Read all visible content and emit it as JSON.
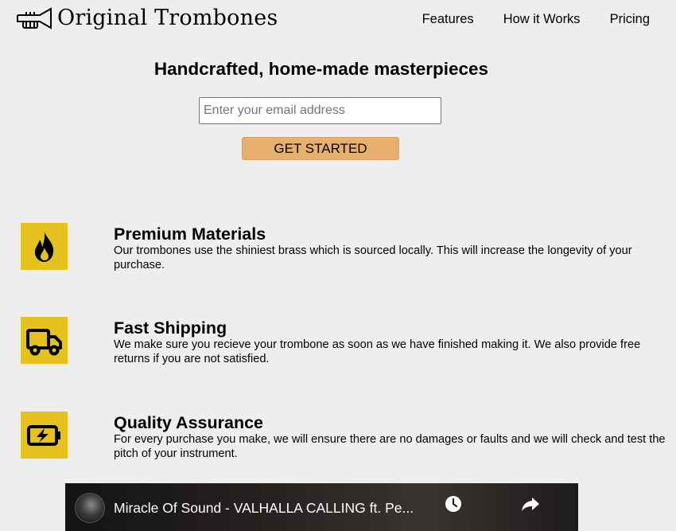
{
  "header": {
    "brand": "Original Trombones",
    "nav": [
      {
        "label": "Features"
      },
      {
        "label": "How it Works"
      },
      {
        "label": "Pricing"
      }
    ]
  },
  "hero": {
    "title": "Handcrafted, home-made masterpieces",
    "email_placeholder": "Enter your email address",
    "email_value": "",
    "cta_label": "GET STARTED"
  },
  "features": [
    {
      "icon": "fire-icon",
      "title": "Premium Materials",
      "description": "Our trombones use the shiniest brass which is sourced locally. This will increase the longevity of your purchase."
    },
    {
      "icon": "truck-icon",
      "title": "Fast Shipping",
      "description": "We make sure you recieve your trombone as soon as we have finished making it. We also provide free returns if you are not satisfied."
    },
    {
      "icon": "battery-bolt-icon",
      "title": "Quality Assurance",
      "description": "For every purchase you make, we will ensure there are no damages or faults and we will check and test the pitch of your instrument."
    }
  ],
  "video": {
    "title": "Miracle Of Sound - VALHALLA CALLING ft. Pe..."
  },
  "colors": {
    "page_background": "#eeeeee",
    "feature_icon_background": "#e6c21f",
    "cta_background": "#e8b06f"
  }
}
